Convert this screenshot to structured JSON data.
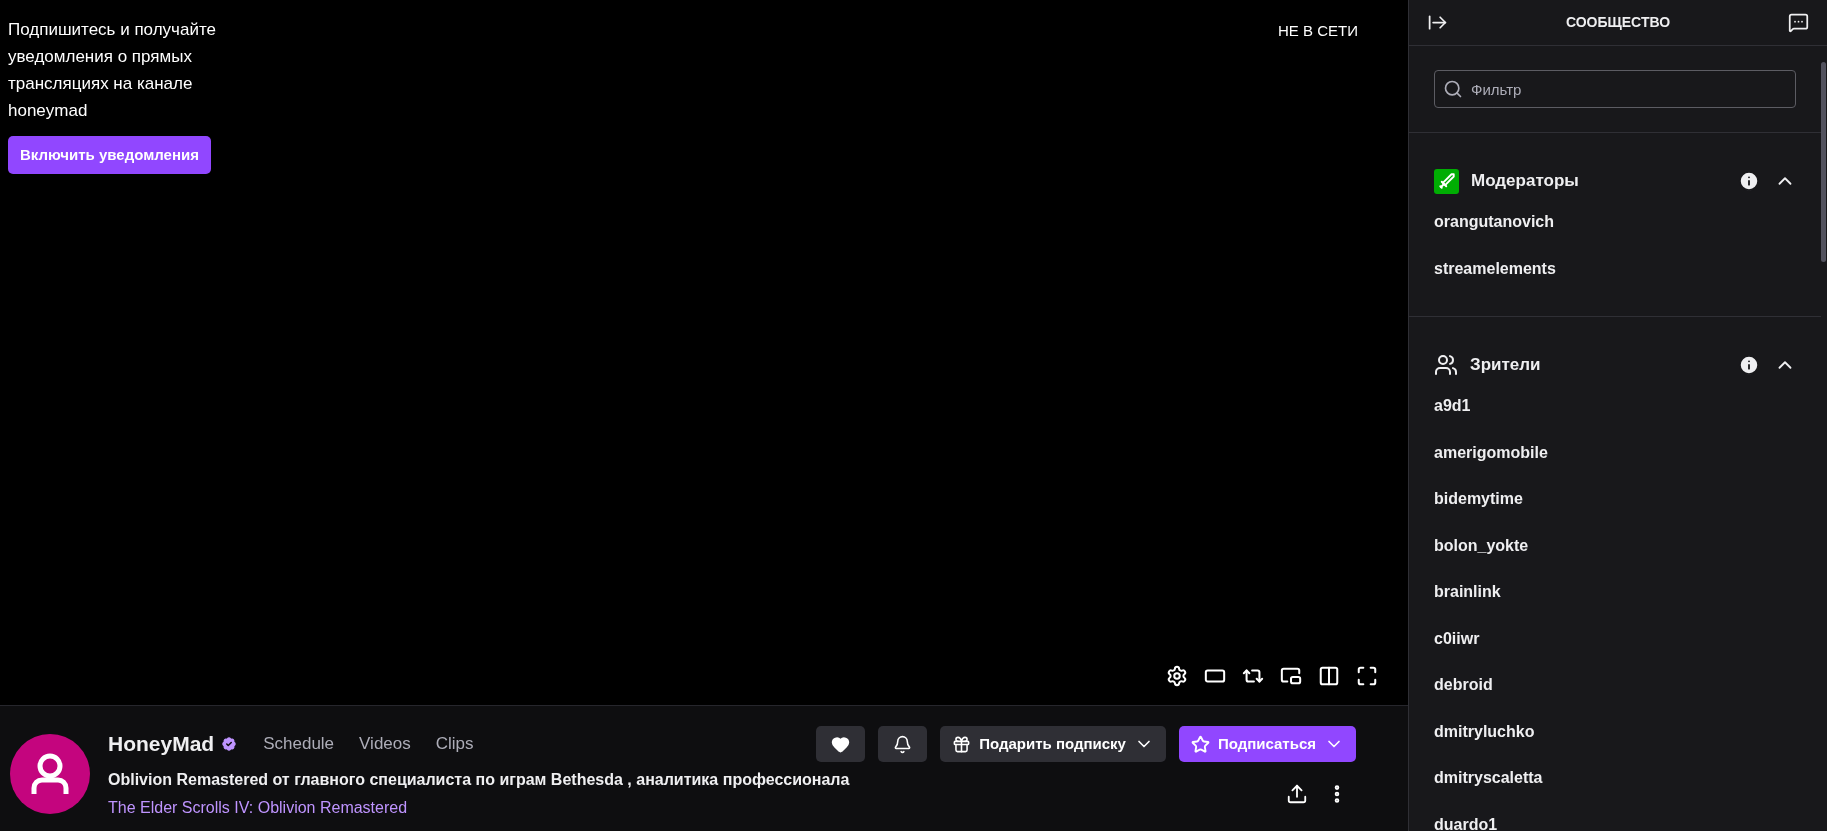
{
  "player": {
    "offline_label": "НЕ В СЕТИ",
    "notice": {
      "text": "Подпишитесь и получайте уведомления о прямых трансляциях на канале honeymad",
      "button": "Включить уведомления"
    }
  },
  "channel": {
    "name": "HoneyMad",
    "verified": true,
    "links": [
      "Schedule",
      "Videos",
      "Clips"
    ],
    "title": "Oblivion Remastered от главного специалиста по играм Bethesda , аналитика профессионала",
    "category": "The Elder Scrolls IV: Oblivion Remastered",
    "gift_button": "Подарить подписку",
    "subscribe_button": "Подписаться"
  },
  "community": {
    "title": "СООБЩЕСТВО",
    "filter": {
      "placeholder": "Фильтр"
    },
    "sections": [
      {
        "kind": "moderators",
        "title": "Модераторы",
        "expanded": true,
        "users": [
          "orangutanovich",
          "streamelements"
        ]
      },
      {
        "kind": "viewers",
        "title": "Зрители",
        "expanded": true,
        "users": [
          "a9d1",
          "amerigomobile",
          "bidemytime",
          "bolon_yokte",
          "brainlink",
          "c0iiwr",
          "debroid",
          "dmitryluchko",
          "dmitryscaletta",
          "duardo1"
        ]
      }
    ]
  }
}
